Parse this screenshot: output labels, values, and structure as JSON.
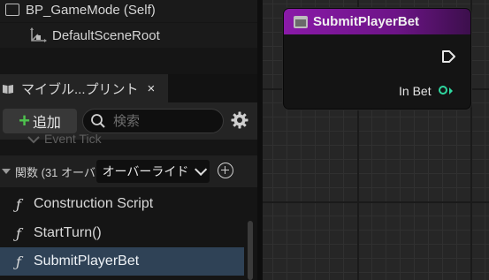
{
  "components": {
    "root_item": "BP_GameMode (Self)",
    "child_item": "DefaultSceneRoot"
  },
  "my_blueprint": {
    "tab_label": "マイブル...プリント",
    "close_glyph": "×",
    "add_label": "追加",
    "search_placeholder": "検索",
    "faded_item": "Event Tick",
    "functions_section": {
      "label": "関数 (31 オーバー",
      "override_label": "オーバーライド"
    },
    "functions": [
      {
        "icon": "function-override-icon",
        "glyph": "ƒ",
        "label": "Construction Script"
      },
      {
        "icon": "function-icon",
        "glyph": "ƒ",
        "label": "StartTurn()"
      },
      {
        "icon": "function-icon",
        "glyph": "ƒ",
        "label": "SubmitPlayerBet"
      }
    ]
  },
  "graph_node": {
    "title": "SubmitPlayerBet",
    "output_pin_label": "In Bet",
    "header_color": "#8a1aa8",
    "pin_color": "#2fd8a0"
  }
}
